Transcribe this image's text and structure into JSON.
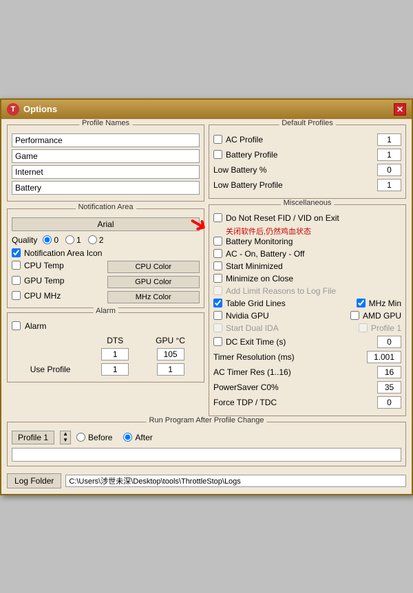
{
  "window": {
    "title": "Options",
    "app_icon": "T",
    "close_label": "✕"
  },
  "profile_names": {
    "section_title": "Profile Names",
    "profiles": [
      "Performance",
      "Game",
      "Internet",
      "Battery"
    ]
  },
  "notification_area": {
    "section_title": "Notification Area",
    "font_label": "Arial",
    "quality_label": "Quality",
    "quality_options": [
      "0",
      "1",
      "2"
    ],
    "notification_icon_label": "Notification Area Icon",
    "cpu_temp_label": "CPU Temp",
    "cpu_color_label": "CPU Color",
    "gpu_temp_label": "GPU Temp",
    "gpu_color_label": "GPU Color",
    "cpu_mhz_label": "CPU MHz",
    "mhz_color_label": "MHz Color"
  },
  "alarm": {
    "section_title": "Alarm",
    "alarm_label": "Alarm",
    "dts_label": "DTS",
    "gpu_label": "GPU °C",
    "dts_value": "1",
    "gpu_value": "105",
    "use_profile_label": "Use Profile",
    "use_profile_dts": "1",
    "use_profile_gpu": "1"
  },
  "default_profiles": {
    "section_title": "Default Profiles",
    "ac_profile_label": "AC Profile",
    "ac_profile_value": "1",
    "battery_profile_label": "Battery Profile",
    "battery_profile_value": "1",
    "low_battery_label": "Low Battery %",
    "low_battery_value": "0",
    "low_battery_profile_label": "Low Battery Profile",
    "low_battery_profile_value": "1"
  },
  "miscellaneous": {
    "section_title": "Miscellaneous",
    "do_not_reset_label": "Do Not Reset FID / VID on Exit",
    "chinese_note": "关闭软件后,仍然鸡血状态",
    "battery_monitoring_label": "Battery Monitoring",
    "ac_on_battery_off_label": "AC - On, Battery - Off",
    "start_minimized_label": "Start Minimized",
    "minimize_on_close_label": "Minimize on Close",
    "add_limit_label": "Add Limit Reasons to Log File",
    "table_grid_label": "Table Grid Lines",
    "mhz_min_label": "MHz Min",
    "nvidia_gpu_label": "Nvidia GPU",
    "amd_gpu_label": "AMD GPU",
    "start_dual_label": "Start Dual IDA",
    "profile1_label": "Profile 1",
    "dc_exit_label": "DC Exit Time (s)",
    "dc_exit_value": "0",
    "timer_res_label": "Timer Resolution (ms)",
    "timer_res_value": "1.001",
    "ac_timer_label": "AC Timer Res (1..16)",
    "ac_timer_value": "16",
    "power_saver_label": "PowerSaver C0%",
    "power_saver_value": "35",
    "force_tdp_label": "Force TDP / TDC",
    "force_tdp_value": "0"
  },
  "run_program": {
    "section_title": "Run Program After Profile Change",
    "profile_btn_label": "Profile 1",
    "before_label": "Before",
    "after_label": "After",
    "run_path_value": ""
  },
  "footer": {
    "log_folder_label": "Log Folder",
    "log_path": "C:\\Users\\涉世未深\\Desktop\\tools\\ThrottleStop\\Logs"
  },
  "checked_states": {
    "ac_profile": false,
    "battery_profile": false,
    "do_not_reset": false,
    "battery_monitoring": false,
    "ac_on_battery_off": false,
    "start_minimized": false,
    "minimize_on_close": false,
    "add_limit": false,
    "table_grid": true,
    "mhz_min": true,
    "nvidia_gpu": false,
    "amd_gpu": false,
    "start_dual": false,
    "profile1": false,
    "dc_exit": false,
    "alarm": false,
    "notification_icon": true,
    "cpu_temp": false,
    "gpu_temp": false,
    "cpu_mhz": false
  }
}
